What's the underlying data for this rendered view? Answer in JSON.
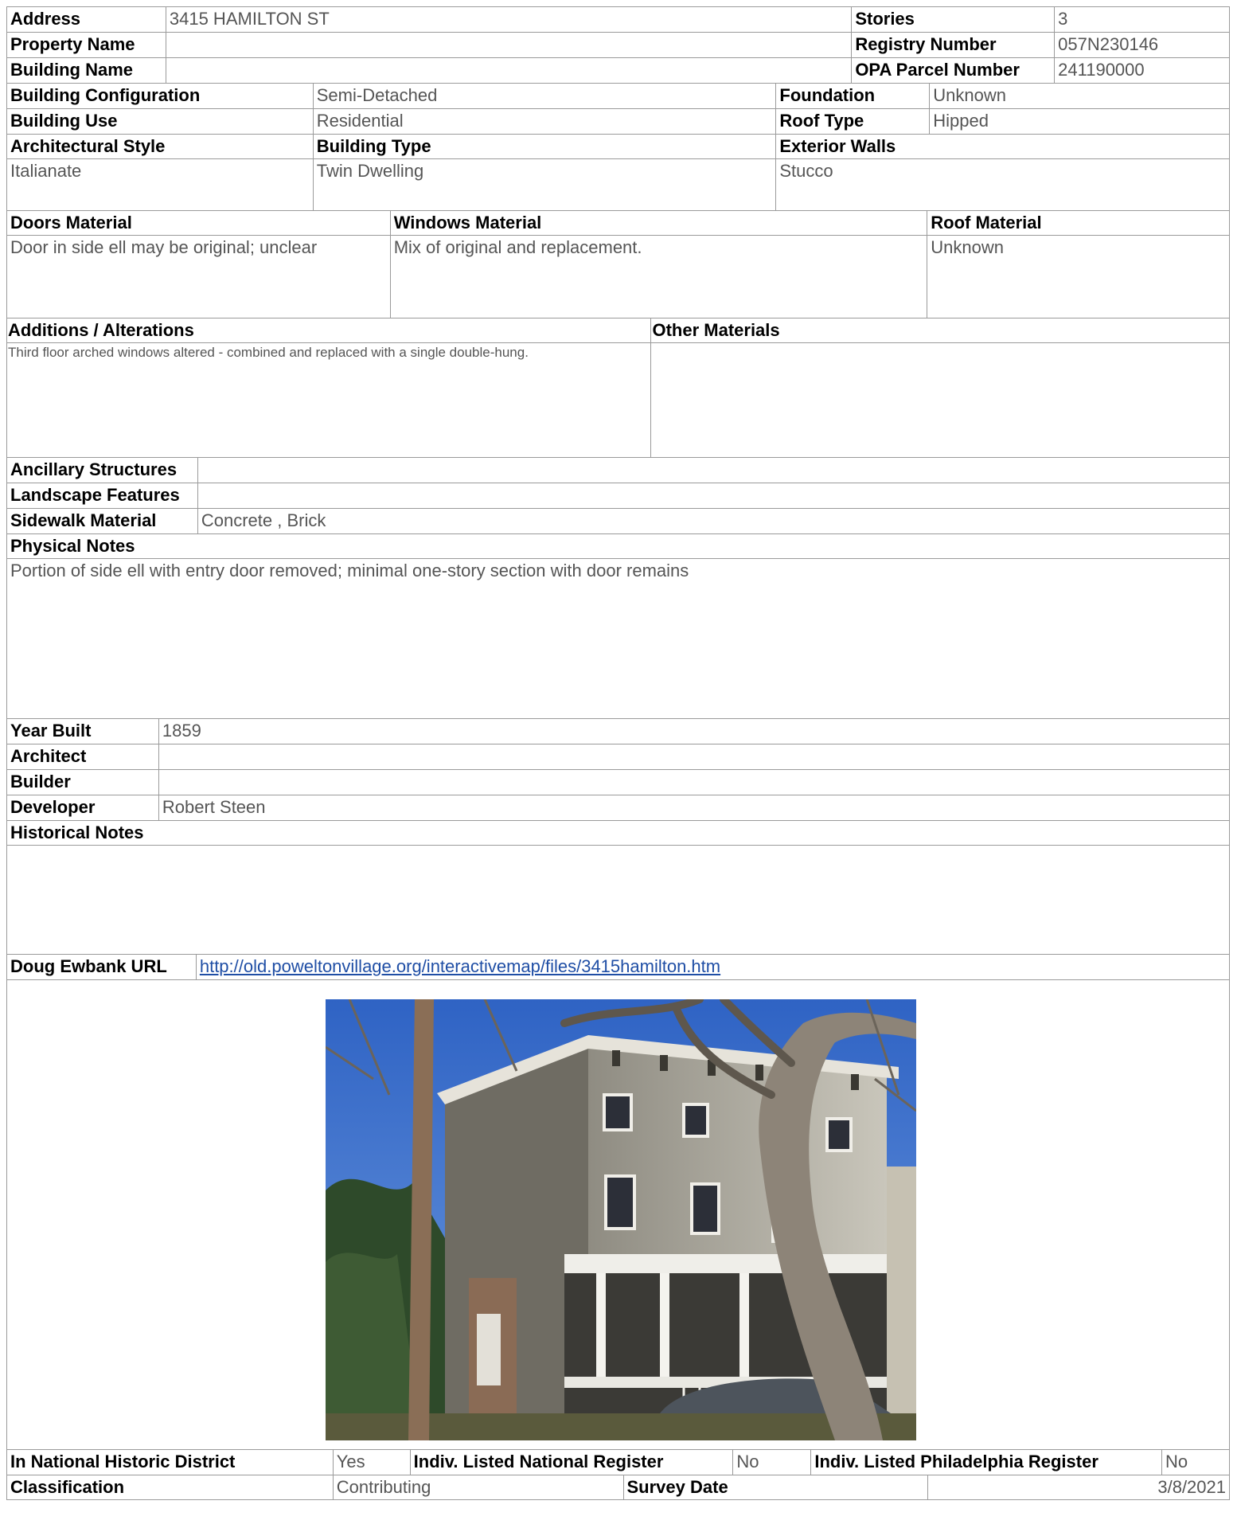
{
  "header": {
    "address_label": "Address",
    "address": "3415 HAMILTON ST",
    "stories_label": "Stories",
    "stories": "3",
    "property_name_label": "Property Name",
    "property_name": "",
    "registry_number_label": "Registry Number",
    "registry_number": "057N230146",
    "building_name_label": "Building Name",
    "building_name": "",
    "opa_label": "OPA Parcel Number",
    "opa": "241190000"
  },
  "config": {
    "building_config_label": "Building Configuration",
    "building_config": "Semi-Detached",
    "foundation_label": "Foundation",
    "foundation": "Unknown",
    "building_use_label": "Building Use",
    "building_use": "Residential",
    "roof_type_label": "Roof Type",
    "roof_type": "Hipped",
    "arch_style_label": "Architectural Style",
    "arch_style": "Italianate",
    "building_type_label": "Building Type",
    "building_type": "Twin Dwelling",
    "exterior_walls_label": "Exterior Walls",
    "exterior_walls": "Stucco"
  },
  "materials": {
    "doors_label": "Doors Material",
    "doors": "Door in side ell may be original; unclear",
    "windows_label": "Windows Material",
    "windows": "Mix of original and replacement.",
    "roof_label": "Roof Material",
    "roof": "Unknown",
    "additions_label": "Additions / Alterations",
    "additions": "Third floor arched windows altered  - combined and replaced with a single double-hung.",
    "other_label": "Other Materials",
    "other": ""
  },
  "site": {
    "ancillary_label": "Ancillary Structures",
    "ancillary": "",
    "landscape_label": "Landscape Features",
    "landscape": "",
    "sidewalk_label": "Sidewalk Material",
    "sidewalk": "Concrete , Brick",
    "physical_notes_label": "Physical Notes",
    "physical_notes": "Portion of side ell with entry door removed; minimal one-story section with door remains"
  },
  "history": {
    "year_built_label": "Year Built",
    "year_built": "1859",
    "architect_label": "Architect",
    "architect": "",
    "builder_label": "Builder",
    "builder": "",
    "developer_label": "Developer",
    "developer": "Robert Steen",
    "historical_notes_label": "Historical Notes",
    "historical_notes": "",
    "ewbank_label": "Doug Ewbank URL",
    "ewbank_url": "http://old.poweltonvillage.org/interactivemap/files/3415hamilton.htm"
  },
  "register": {
    "national_district_label": "In National Historic District",
    "national_district": "Yes",
    "indiv_national_label": "Indiv. Listed National Register",
    "indiv_national": "No",
    "indiv_phila_label": "Indiv. Listed Philadelphia Register",
    "indiv_phila": "No",
    "classification_label": "Classification",
    "classification": "Contributing",
    "survey_date_label": "Survey Date",
    "survey_date": "3/8/2021"
  }
}
